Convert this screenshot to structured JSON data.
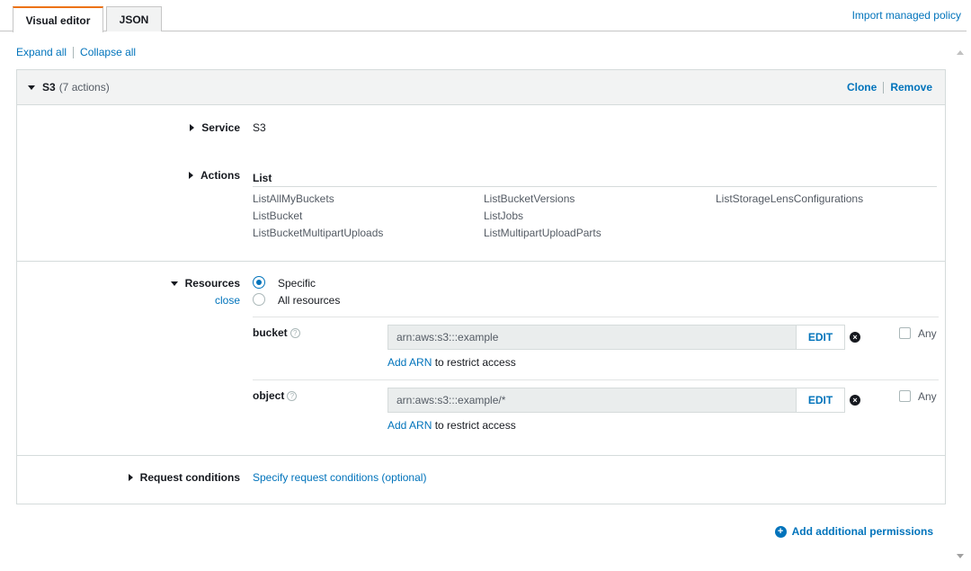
{
  "tabs": [
    {
      "label": "Visual editor",
      "active": true
    },
    {
      "label": "JSON",
      "active": false
    }
  ],
  "import_label": "Import managed policy",
  "expand_all": "Expand all",
  "collapse_all": "Collapse all",
  "panel": {
    "title": "S3",
    "subtitle": "(7 actions)",
    "clone": "Clone",
    "remove": "Remove"
  },
  "service": {
    "label": "Service",
    "value": "S3"
  },
  "actions": {
    "label": "Actions",
    "group": "List",
    "items": [
      "ListAllMyBuckets",
      "ListBucketVersions",
      "ListStorageLensConfigurations",
      "ListBucket",
      "ListJobs",
      "ListBucketMultipartUploads",
      "ListMultipartUploadParts"
    ]
  },
  "resources": {
    "label": "Resources",
    "close": "close",
    "options": [
      "Specific",
      "All resources"
    ],
    "selected": "Specific",
    "items": [
      {
        "name": "bucket",
        "arn": "arn:aws:s3:::example",
        "edit": "EDIT",
        "add_arn": "Add ARN",
        "restrict": " to restrict access",
        "any": "Any"
      },
      {
        "name": "object",
        "arn": "arn:aws:s3:::example/*",
        "edit": "EDIT",
        "add_arn": "Add ARN",
        "restrict": " to restrict access",
        "any": "Any"
      }
    ]
  },
  "conditions": {
    "label": "Request conditions",
    "link": "Specify request conditions (optional)"
  },
  "add_permissions": "Add additional permissions",
  "colors": {
    "link": "#0073bb",
    "tab_accent": "#ec7211",
    "header_bg": "#f2f3f3"
  },
  "icons": [
    "caret-down-icon",
    "caret-right-icon",
    "help-icon",
    "remove-icon",
    "plus-circle-icon"
  ]
}
